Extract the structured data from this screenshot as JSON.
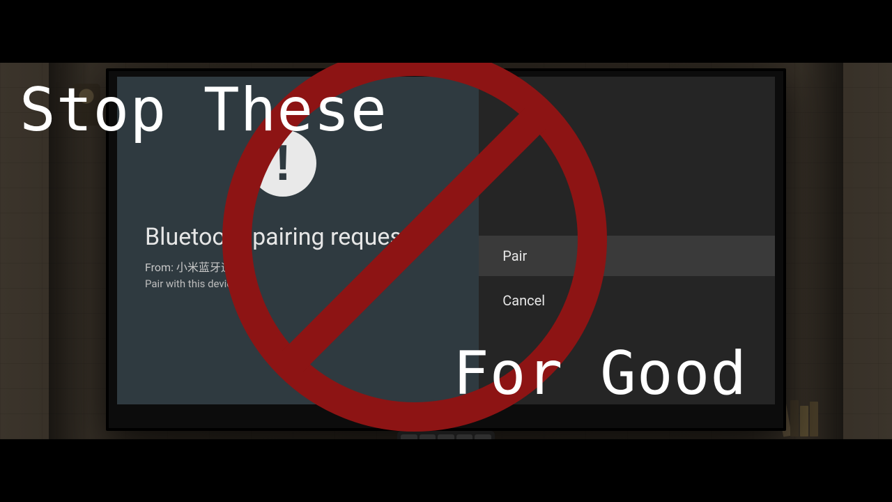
{
  "overlay": {
    "line1": "Stop These",
    "line2": "For Good"
  },
  "dialog": {
    "icon_glyph": "!",
    "title": "Bluetooth pairing request",
    "from_label": "From:",
    "from_value": "小米蓝牙遥控器",
    "question": "Pair with this device?",
    "options": {
      "pair": "Pair",
      "cancel": "Cancel"
    }
  },
  "colors": {
    "prohibition": "#8d1414",
    "dialog_left": "#2f3a40",
    "dialog_right": "#252525"
  }
}
